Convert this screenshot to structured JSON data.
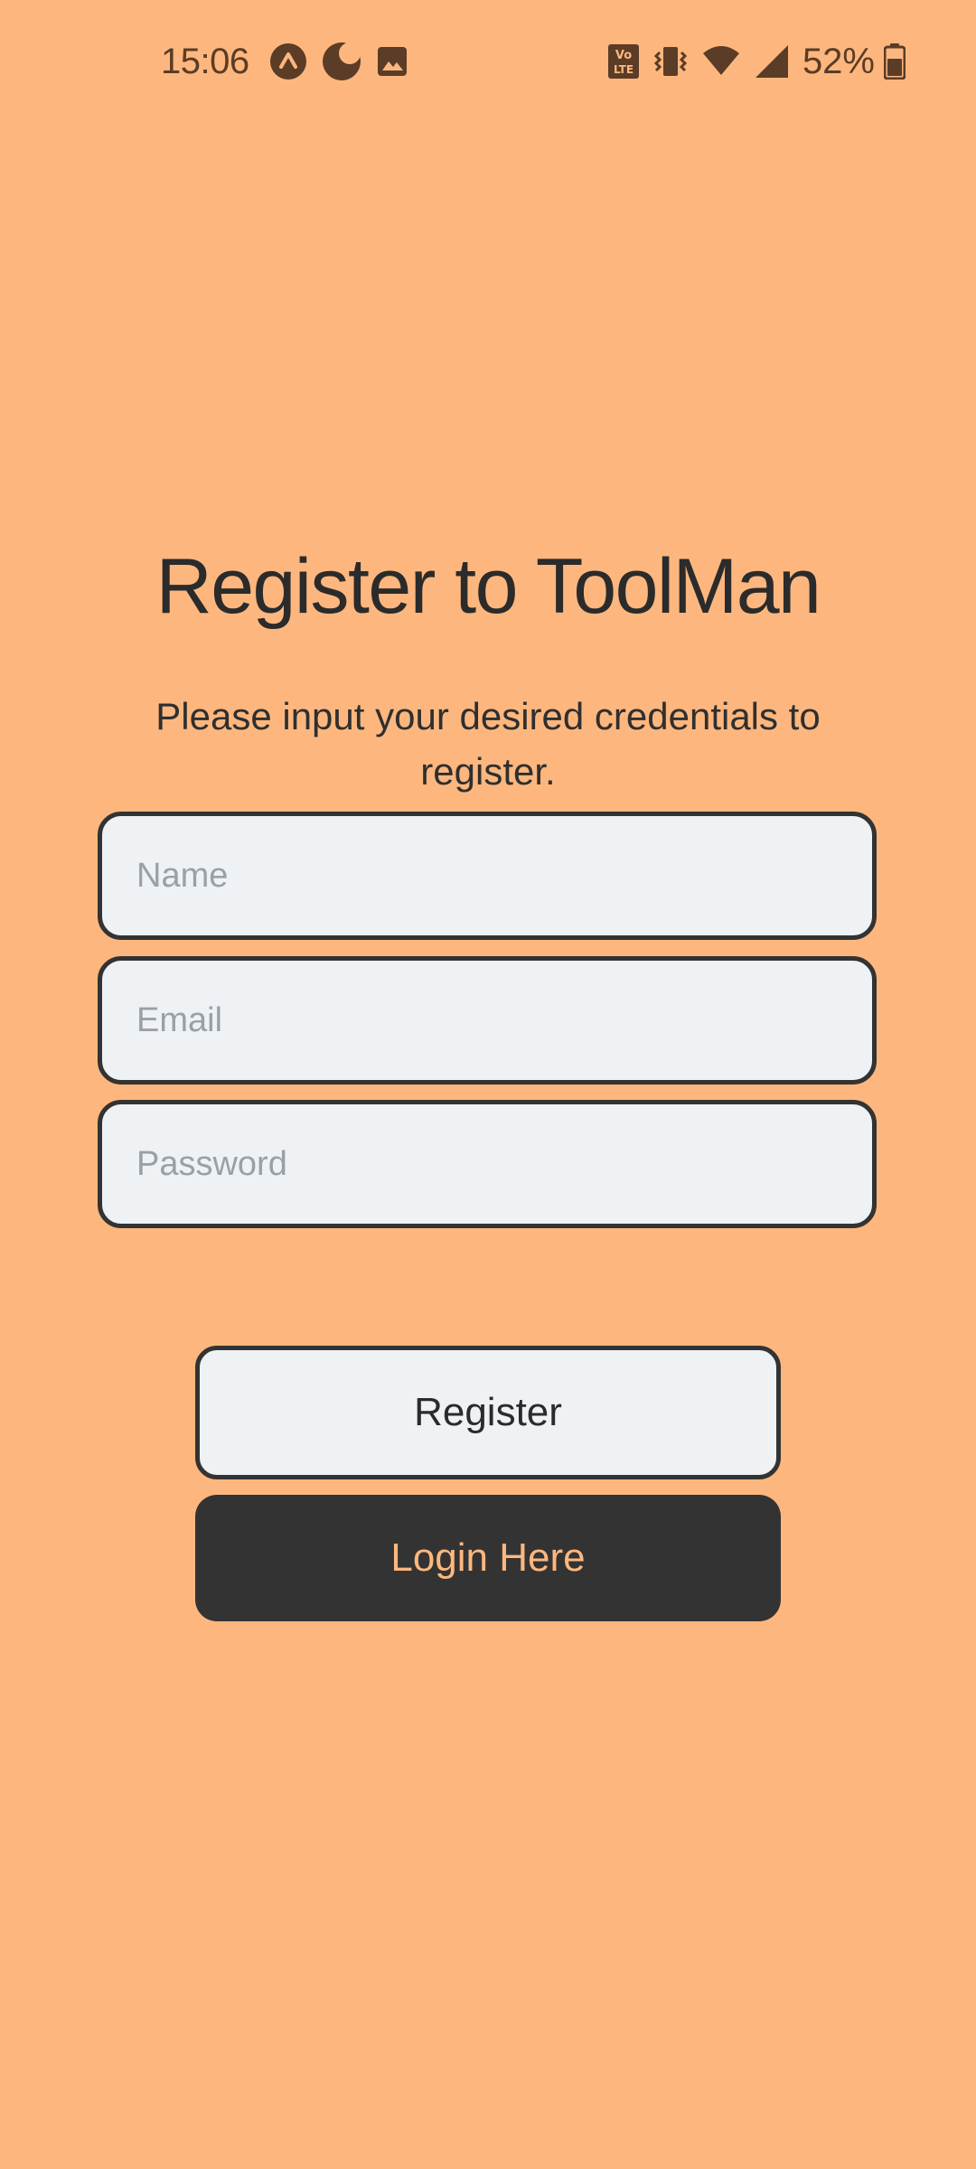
{
  "status_bar": {
    "time": "15:06",
    "battery_percent": "52%",
    "left_icons": [
      "expo-icon",
      "night-mode-icon",
      "image-icon"
    ],
    "right_icons": [
      "volte-icon",
      "vibrate-icon",
      "wifi-icon",
      "signal-icon",
      "battery-icon"
    ],
    "icon_color": "#5B3C26"
  },
  "header": {
    "title": "Register to ToolMan",
    "subtitle": "Please input your desired credentials to register."
  },
  "form": {
    "name_placeholder": "Name",
    "email_placeholder": "Email",
    "password_placeholder": "Password",
    "name_value": "",
    "email_value": "",
    "password_value": ""
  },
  "actions": {
    "register_label": "Register",
    "login_label": "Login Here"
  },
  "colors": {
    "background": "#FDB77E",
    "field_bg": "#EFF2F5",
    "border": "#333333",
    "dark_button": "#333333",
    "accent_text": "#FDB77E"
  }
}
